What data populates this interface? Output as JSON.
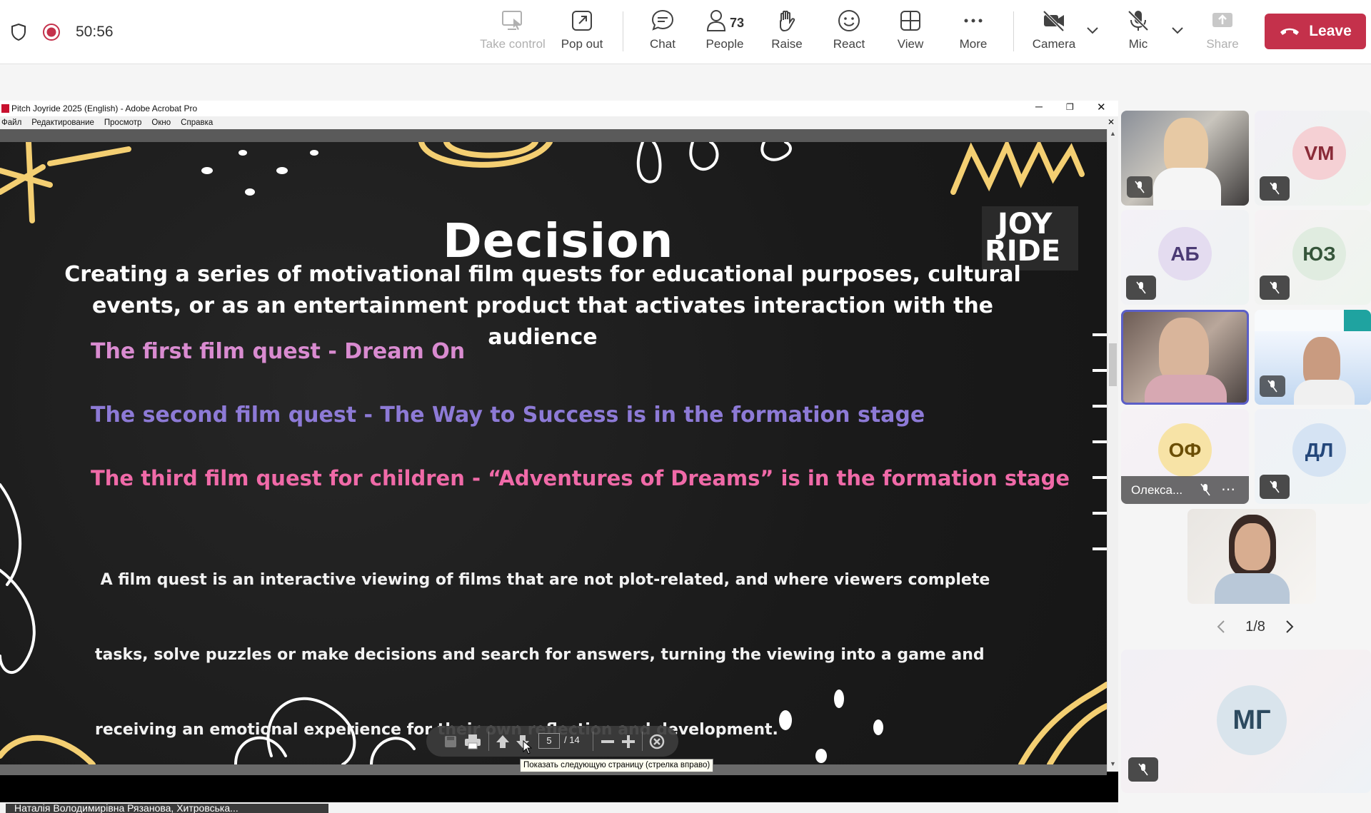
{
  "status": {
    "timer": "50:56"
  },
  "toolbar": {
    "take_control": "Take control",
    "pop_out": "Pop out",
    "chat": "Chat",
    "people": "People",
    "people_count": "73",
    "raise": "Raise",
    "react": "React",
    "view": "View",
    "more": "More",
    "camera": "Camera",
    "mic": "Mic",
    "share": "Share",
    "leave": "Leave"
  },
  "acrobat": {
    "title": "Pitch Joyride 2025 (English) - Adobe Acrobat Pro",
    "menu": [
      "Файл",
      "Редактирование",
      "Просмотр",
      "Окно",
      "Справка"
    ],
    "page_current": "5",
    "page_total": "/ 14",
    "tooltip": "Показать следующую страницу (стрелка вправо)"
  },
  "slide": {
    "title": "Decision",
    "logo_line1": "JOY",
    "logo_line2": "RIDE",
    "intro_1": "Creating a series of motivational film quests for educational purposes, cultural",
    "intro_2": "events, or as an entertainment product that activates interaction with the",
    "intro_3": "audience",
    "quest_1": "The first film quest - Dream On",
    "quest_2": "The second film quest - The Way to Success is in the formation stage",
    "quest_3": "The third film quest for children - “Adventures of Dreams” is in the formation stage",
    "desc_1": " A film quest is an interactive viewing of films that are not plot-related, and where viewers complete",
    "desc_2": "tasks, solve puzzles or make decisions and search for answers, turning the viewing into a game and",
    "desc_3": "receiving an emotional experience for their own reflection and development.",
    "colors": {
      "quest_1": "#d98bd0",
      "quest_2": "#8d7ad6",
      "quest_3": "#f06aa8",
      "doodle": "#f4cf72"
    }
  },
  "participants": {
    "vm": "VM",
    "ab": "АБ",
    "yuz": "ЮЗ",
    "of": "ОФ",
    "of_name": "Олекса...",
    "dl": "ДЛ",
    "mg": "МГ",
    "pager": "1/8"
  },
  "bottom_name": "Наталія Володимирівна Рязанова, Хитровська..."
}
